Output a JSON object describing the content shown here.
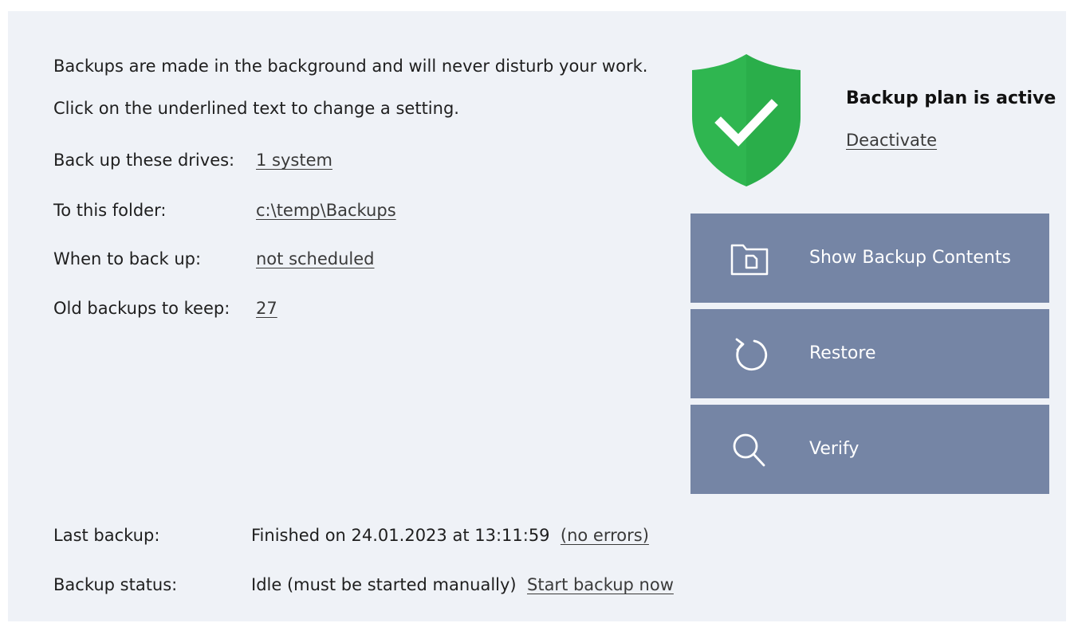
{
  "intro": {
    "line1": "Backups are made in the background and will never disturb your work.",
    "line2": "Click on the underlined text to change a setting."
  },
  "settings": [
    {
      "label": "Back up these drives:",
      "value": "1 system"
    },
    {
      "label": "To this folder:",
      "value": "c:\\temp\\Backups"
    },
    {
      "label": "When to back up:",
      "value": "not scheduled"
    },
    {
      "label": "Old backups to keep:",
      "value": "27"
    }
  ],
  "status": {
    "title": "Backup plan is active",
    "deactivate_label": "Deactivate",
    "shield_icon": "shield-check-icon",
    "shield_color": "#2fb650",
    "check_color": "#ffffff"
  },
  "actions": [
    {
      "label": "Show Backup Contents",
      "icon": "folder-file-icon"
    },
    {
      "label": "Restore",
      "icon": "restore-icon"
    },
    {
      "label": "Verify",
      "icon": "search-icon"
    }
  ],
  "accent_color": "#7585a5",
  "last_backup": {
    "label": "Last backup:",
    "value": "Finished on 24.01.2023 at 13:11:59",
    "link": "(no errors)"
  },
  "backup_status": {
    "label": "Backup status:",
    "value": "Idle (must be started manually)",
    "link": "Start backup now"
  }
}
